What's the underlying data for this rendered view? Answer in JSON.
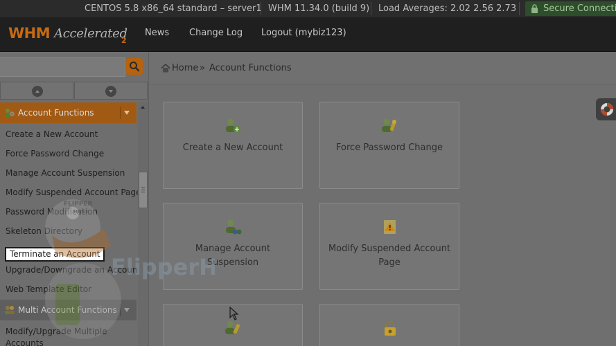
{
  "status_bar": {
    "server": "CENTOS 5.8 x86_64 standard – server1",
    "version": "WHM 11.34.0 (build 9)",
    "load": "Load Averages: 2.02 2.56 2.73",
    "secure": "Secure Connection"
  },
  "header": {
    "logo_whm": "WHM",
    "logo_accelerated": "Accelerated",
    "logo_version": "2",
    "nav": [
      "News",
      "Change Log",
      "Logout (mybiz123)"
    ]
  },
  "sidebar": {
    "search": {
      "value": "",
      "placeholder": ""
    },
    "sections": [
      {
        "title": "Account Functions",
        "items": [
          "Create a New Account",
          "Force Password Change",
          "Manage Account Suspension",
          "Modify Suspended Account Page",
          "Password Modification",
          "Skeleton Directory",
          "Terminate an Account",
          "Upgrade/Downgrade an Account",
          "Web Template Editor"
        ]
      },
      {
        "title": "Multi Account Functions",
        "items": [
          "Modify/Upgrade Multiple",
          "Accounts"
        ]
      }
    ]
  },
  "breadcrumb": {
    "home": "Home",
    "separator": "»",
    "current": "Account Functions"
  },
  "cards": [
    {
      "label": "Create a New Account"
    },
    {
      "label": "Force Password Change"
    },
    {
      "label": "Manage Account Suspension"
    },
    {
      "label_line1": "Modify Suspended Account",
      "label_line2": "Page"
    },
    {
      "label": ""
    },
    {
      "label": ""
    }
  ],
  "watermark": {
    "text1": "FLIPPER",
    "text2": "HOST",
    "text3": "FlipperHost"
  },
  "colors": {
    "accent": "#c56a15",
    "active_section": "#a15a14",
    "page_bg": "#6f6f6f"
  }
}
